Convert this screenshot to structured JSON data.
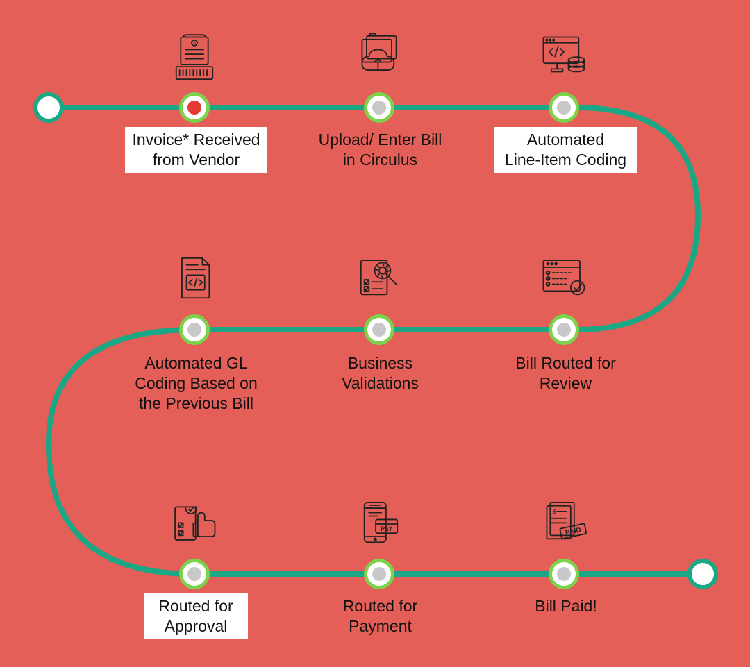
{
  "colors": {
    "bg": "#e45f57",
    "path": "#19a786",
    "nodeRing": "#7bd34b",
    "nodeDot": "#c8c8c8",
    "nodeDotActive": "#e53935",
    "box": "#ffffff"
  },
  "steps": [
    {
      "id": "invoice-received",
      "label": "Invoice* Received\nfrom Vendor",
      "icon": "invoice-icon",
      "boxed": true,
      "active": true
    },
    {
      "id": "upload-bill",
      "label": "Upload/ Enter Bill\nin Circulus",
      "icon": "upload-cloud-icon",
      "boxed": false,
      "active": false
    },
    {
      "id": "line-item-coding",
      "label": "Automated\nLine-Item Coding",
      "icon": "code-monitor-icon",
      "boxed": true,
      "active": false
    },
    {
      "id": "gl-coding",
      "label": "Automated GL\nCoding Based on\nthe Previous Bill",
      "icon": "code-document-icon",
      "boxed": false,
      "active": false
    },
    {
      "id": "business-validations",
      "label": "Business\nValidations",
      "icon": "validate-icon",
      "boxed": false,
      "active": false
    },
    {
      "id": "routed-review",
      "label": "Bill Routed for\nReview",
      "icon": "review-window-icon",
      "boxed": false,
      "active": false
    },
    {
      "id": "routed-approval",
      "label": "Routed for\nApproval",
      "icon": "approval-icon",
      "boxed": true,
      "active": false
    },
    {
      "id": "routed-payment",
      "label": "Routed for\nPayment",
      "icon": "pay-icon",
      "boxed": false,
      "active": false
    },
    {
      "id": "bill-paid",
      "label": "Bill Paid!",
      "icon": "paid-stamp-icon",
      "boxed": false,
      "active": false
    }
  ]
}
